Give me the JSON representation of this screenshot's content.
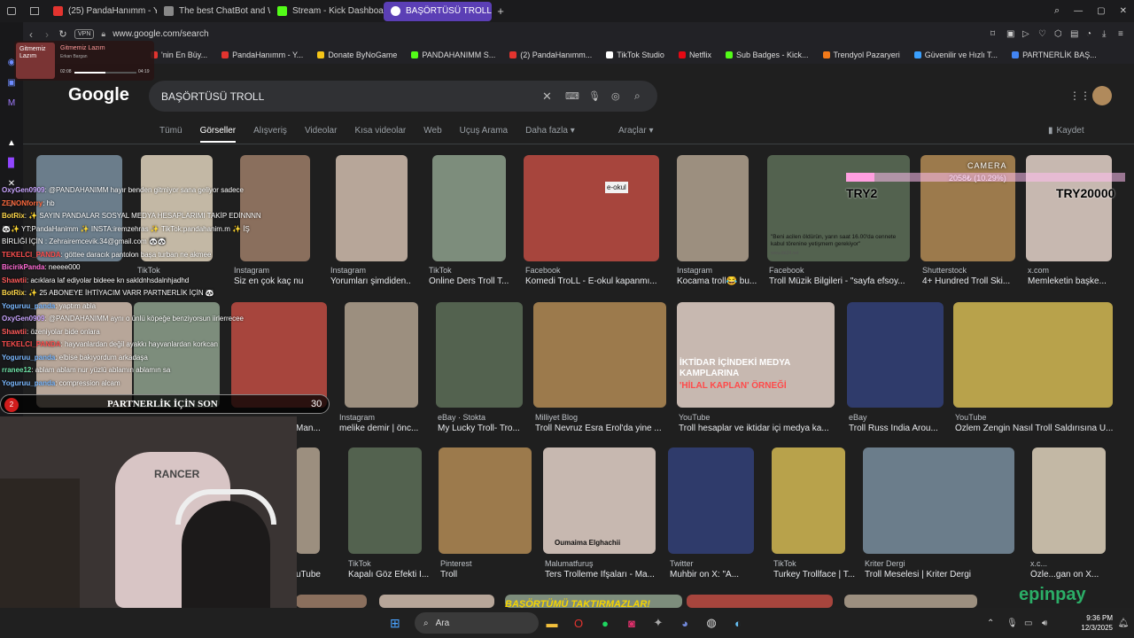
{
  "tabs": [
    {
      "label": "(25) PandaHanımm - You",
      "color": "#e3342f"
    },
    {
      "label": "The best ChatBot and Wi",
      "color": "#888888"
    },
    {
      "label": "Stream - Kick Dashboard",
      "color": "#53fc18"
    },
    {
      "label": "BAŞÖRTÜSÜ TROLL - Goo",
      "color": "#ffffff"
    }
  ],
  "address": {
    "vpn": "VPN",
    "url": "www.google.com/search"
  },
  "bookmarks": [
    {
      "label": "'nin En Büy...",
      "color": "#e3342f"
    },
    {
      "label": "PandaHanımm - Y...",
      "color": "#e3342f"
    },
    {
      "label": "Donate ByNoGame",
      "color": "#f5c518"
    },
    {
      "label": "PANDAHANIMM S...",
      "color": "#53fc18"
    },
    {
      "label": "(2) PandaHanımm...",
      "color": "#e3342f"
    },
    {
      "label": "TikTok Studio",
      "color": "#ffffff"
    },
    {
      "label": "Netflix",
      "color": "#e50914"
    },
    {
      "label": "Sub Badges - Kick...",
      "color": "#53fc18"
    },
    {
      "label": "Trendyol Pazaryeri",
      "color": "#f27a1a"
    },
    {
      "label": "Güvenilir ve Hızlı T...",
      "color": "#3aa0ff"
    },
    {
      "label": "PARTNERLİK BAŞ...",
      "color": "#4285f4"
    }
  ],
  "media": {
    "title": "Gitmemiz Lazım",
    "artist": "Erkan Bargan",
    "time_left": "02:08",
    "time_right": "04:19",
    "cover_text": "Gitmemiz Lazım",
    "progress": 0.5
  },
  "google": {
    "logo": "Google",
    "query": "BAŞÖRTÜSÜ TROLL",
    "tabs": [
      "Tümü",
      "Görseller",
      "Alışveriş",
      "Videolar",
      "Kısa videolar",
      "Web",
      "Uçuş Arama",
      "Daha fazla ▾"
    ],
    "active_tab": "Görseller",
    "tools": "Araçlar ▾",
    "saved": "Kaydet"
  },
  "row1": [
    {
      "source": "Instagram",
      "title": "Siz en çok kaç nu..."
    },
    {
      "source": "Instagram",
      "title": "Yorumları şimdiden..."
    },
    {
      "source": "TikTok",
      "title": "Online Ders Troll T..."
    },
    {
      "source": "Facebook",
      "title": "Komedi TroLL - E-okul kapanmı..."
    },
    {
      "source": "Instagram",
      "title": "Kocama troll😂 bu..."
    },
    {
      "source": "Facebook",
      "title": "Troll Müzik Bilgileri - \"sayfa efsoy..."
    },
    {
      "source": "Shutterstock",
      "title": "4+ Hundred Troll Ski..."
    },
    {
      "source": "x.com",
      "title": "Memleketin başke..."
    }
  ],
  "row2": [
    {
      "source": "",
      "title": "Man..."
    },
    {
      "source": "Instagram",
      "title": "melike demir | önc..."
    },
    {
      "source": "eBay · Stokta",
      "title": "My Lucky Troll- Tro..."
    },
    {
      "source": "Milliyet Blog",
      "title": "Troll Nevruz Esra Erol'da yine ..."
    },
    {
      "source": "YouTube",
      "title": "Troll hesaplar ve iktidar içi medya ka..."
    },
    {
      "source": "eBay",
      "title": "Troll Russ India Arou..."
    },
    {
      "source": "YouTube",
      "title": "Özlem Zengin Nasıl Troll Saldırısına U..."
    }
  ],
  "row3": [
    {
      "source": "",
      "title": "uTube"
    },
    {
      "source": "TikTok",
      "title": "Kapalı Göz Efekti I..."
    },
    {
      "source": "Pinterest",
      "title": "Troll"
    },
    {
      "source": "Malumatfuruş",
      "title": "Ters Trolleme İfşaları - Ma..."
    },
    {
      "source": "Twitter",
      "title": "Muhbir on X: \"A..."
    },
    {
      "source": "TikTok",
      "title": "Turkey Trollface | T..."
    },
    {
      "source": "Kriter Dergi",
      "title": "Troll Meselesi | Kriter Dergi"
    },
    {
      "source": "x.c...",
      "title": "Özle...gan on X..."
    }
  ],
  "left_row1_sources": [
    "TikTok"
  ],
  "image_texts": {
    "okul": "e-okul",
    "news_caption": "\"Beni acilen öldürün, yarın saat 16.00'da cennete kabul törenine yetişmem gerekiyor\"",
    "news_site": "www.tbt24.net",
    "iktidar": "İKTİDAR İÇİNDEKİ MEDYA KAMPLARINA",
    "hilal": "'HİLAL KAPLAN' ÖRNEĞİ",
    "oumaima": "Oumaima Elghachii",
    "bottom_strip": "BAŞÖRTÜMÜ TAKTIRMAZLAR!"
  },
  "overlay": {
    "camera": "CAMERA",
    "goal_amount": "2058₺ (10.29%)",
    "goal_progress": 0.1029,
    "try_left": "TRY2",
    "try_right": "TRY20000",
    "partnership": "PARTNERLİK İÇİN SON",
    "partnership_count": "30",
    "partnership_badge": "2",
    "brand": "epinpay"
  },
  "chat": [
    {
      "user": "OxyGen0909",
      "msg": ": @PANDAHANIMM hayır benden gitmiyor sana geliyor sadece",
      "color": "#c9a5ff"
    },
    {
      "user": "ZENONforry",
      "msg": ": hb",
      "color": "#ff6a3d"
    },
    {
      "user": "BotRix",
      "msg": ": ✨ SAYIN PANDALAR SOSYAL MEDYA HESAPLARIMI TAKİP EDİNNNN",
      "color": "#ffd84a"
    },
    {
      "user": "",
      "msg": "🐼✨ YT:PandaHanimm ✨ INSTA:iremzehras ✨ TikTok:pandahanim.m ✨ İŞ",
      "color": "#ffffff"
    },
    {
      "user": "",
      "msg": "BİRLİĞİ İÇİN : Zehrairemcevik.34@gmail.com 🐼🐼",
      "color": "#ffffff"
    },
    {
      "user": "TEKELCI_PANDA",
      "msg": ": göttee daracık pantolon başa turban ne akmee",
      "color": "#ff4f4f"
    },
    {
      "user": "BicirikPanda",
      "msg": ": neeee000",
      "color": "#ff6ad5"
    },
    {
      "user": "Shawtii",
      "msg": ": acıklara laf ediyolar bideee kn sakldnhsdalnhjadhd",
      "color": "#ff5a5a"
    },
    {
      "user": "BotRix",
      "msg": ": ✨ 25 ABONEYE İHTİYACIM VARR PARTNERLİK İÇİN 🐼",
      "color": "#ffd84a"
    },
    {
      "user": "Yoguruu_panda",
      "msg": ": yaptım abla",
      "color": "#7ab8ff"
    },
    {
      "user": "OxyGen0909",
      "msg": ": @PANDAHANIMM aynı o ünlü köpeğe benziyorsun iirlerrecee",
      "color": "#c9a5ff"
    },
    {
      "user": "Shawtii",
      "msg": ": özeniyolar bide onlara",
      "color": "#ff5a5a"
    },
    {
      "user": "TEKELCI_PANDA",
      "msg": ": hayvanlardan değil ayakkı hayvanlardan korkcan",
      "color": "#ff4f4f"
    },
    {
      "user": "Yoguruu_panda",
      "msg": ": elbise bakıyordum arkadaşa",
      "color": "#7ab8ff"
    },
    {
      "user": "rranee12",
      "msg": ": ablam ablam nur yüzlü ablamın ablamın sa",
      "color": "#6fe3a8"
    },
    {
      "user": "Yoguruu_panda",
      "msg": ": compression alcam",
      "color": "#7ab8ff"
    }
  ],
  "webcam": {
    "chair_brand": "RANCER"
  },
  "taskbar": {
    "search": "Ara",
    "time": "9:36 PM",
    "date": "12/3/2025"
  }
}
